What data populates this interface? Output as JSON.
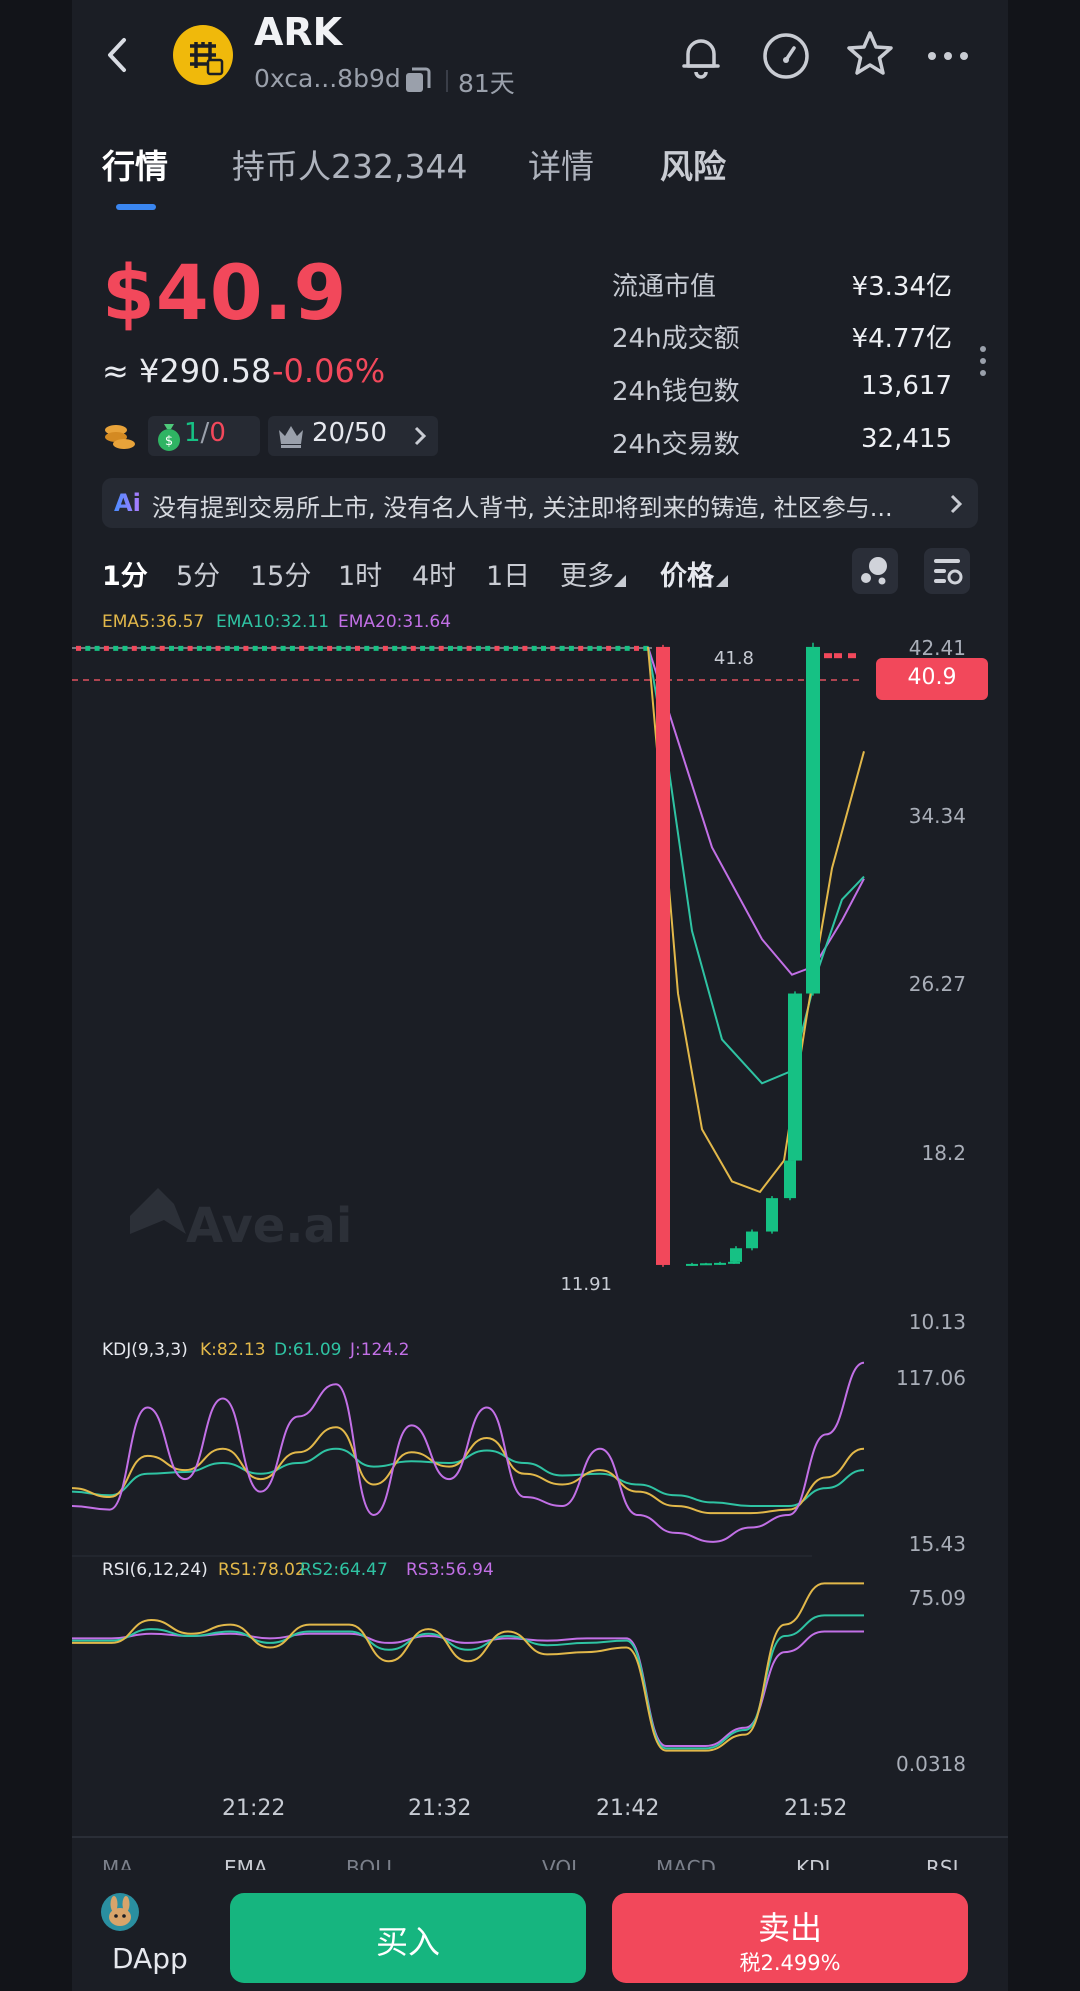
{
  "header": {
    "title": "ARK",
    "address": "0xca...8b9d",
    "age": "81天"
  },
  "tabs": [
    {
      "label": "行情",
      "active": true
    },
    {
      "label": "持币人232,344",
      "active": false
    },
    {
      "label": "详情",
      "active": false
    },
    {
      "label": "风险",
      "active": false
    }
  ],
  "price": {
    "usd": "$40.9",
    "cny": "≈ ¥290.58",
    "change": "-0.06%"
  },
  "chips": {
    "buy_sell_buy": "1",
    "buy_sell_sep": "/",
    "buy_sell_sell": "0",
    "top_holders": "20/50"
  },
  "stats": [
    {
      "label": "流通市值",
      "value": "¥3.34亿"
    },
    {
      "label": "24h成交额",
      "value": "¥4.77亿"
    },
    {
      "label": "24h钱包数",
      "value": "13,617"
    },
    {
      "label": "24h交易数",
      "value": "32,415"
    }
  ],
  "ai_summary": "没有提到交易所上市, 没有名人背书, 关注即将到来的铸造, 社区参与...",
  "timeframes": [
    {
      "label": "1分",
      "active": true
    },
    {
      "label": "5分",
      "active": false
    },
    {
      "label": "15分",
      "active": false
    },
    {
      "label": "1时",
      "active": false
    },
    {
      "label": "4时",
      "active": false
    },
    {
      "label": "1日",
      "active": false
    },
    {
      "label": "更多",
      "active": false
    },
    {
      "label": "价格",
      "active": false
    }
  ],
  "chart_data": {
    "type": "candlestick",
    "ema_legend": {
      "ema5": "EMA5:36.57",
      "ema10": "EMA10:32.11",
      "ema20": "EMA20:31.64"
    },
    "price_axis": [
      "42.41",
      "34.34",
      "26.27",
      "18.2",
      "10.13"
    ],
    "current_price_tag": "40.9",
    "high_label": "41.8",
    "low_label": "11.91",
    "time_labels": [
      "21:22",
      "21:32",
      "21:42",
      "21:52"
    ],
    "watermark": "Ave.ai",
    "price_range": [
      10.13,
      42.41
    ],
    "candles": [
      {
        "o": 41.6,
        "h": 41.7,
        "l": 11.91,
        "c": 12.0
      },
      {
        "o": 12.0,
        "h": 12.1,
        "l": 11.95,
        "c": 12.05
      },
      {
        "o": 12.05,
        "h": 12.1,
        "l": 12.0,
        "c": 12.08
      },
      {
        "o": 12.08,
        "h": 12.15,
        "l": 12.0,
        "c": 12.1
      },
      {
        "o": 12.1,
        "h": 12.2,
        "l": 12.05,
        "c": 12.15
      },
      {
        "o": 12.15,
        "h": 12.9,
        "l": 12.1,
        "c": 12.8
      },
      {
        "o": 12.8,
        "h": 13.7,
        "l": 12.7,
        "c": 13.6
      },
      {
        "o": 13.6,
        "h": 15.3,
        "l": 13.5,
        "c": 15.2
      },
      {
        "o": 15.2,
        "h": 17.1,
        "l": 15.1,
        "c": 17.0
      },
      {
        "o": 17.0,
        "h": 25.1,
        "l": 16.9,
        "c": 25.0
      },
      {
        "o": 25.0,
        "h": 41.8,
        "l": 24.9,
        "c": 41.6
      }
    ],
    "kdj": {
      "legend": {
        "name": "KDJ(9,3,3)",
        "k": "K:82.13",
        "d": "D:61.09",
        "j": "J:124.2"
      },
      "axis": [
        "117.06",
        "15.43"
      ],
      "range": [
        15.43,
        117.06
      ],
      "k": [
        50,
        45,
        68,
        60,
        72,
        55,
        70,
        84,
        52,
        70,
        62,
        78,
        58,
        52,
        60,
        48,
        40,
        36,
        36,
        38,
        56,
        72
      ],
      "d": [
        48,
        46,
        58,
        59,
        64,
        58,
        64,
        72,
        62,
        65,
        64,
        71,
        64,
        57,
        58,
        52,
        46,
        42,
        40,
        40,
        50,
        60
      ],
      "j": [
        40,
        38,
        95,
        55,
        100,
        48,
        90,
        108,
        35,
        85,
        55,
        95,
        45,
        40,
        72,
        35,
        25,
        20,
        28,
        35,
        80,
        120
      ]
    },
    "rsi": {
      "legend": {
        "name": "RSI(6,12,24)",
        "rs1": "RS1:78.02",
        "rs2": "RS2:64.47",
        "rs3": "RS3:56.94"
      },
      "axis": [
        "75.09",
        "0.0318"
      ],
      "range": [
        0.0318,
        75.09
      ],
      "rs1": [
        52,
        52,
        62,
        56,
        60,
        50,
        60,
        60,
        44,
        58,
        44,
        57,
        47,
        48,
        50,
        5,
        5,
        12,
        60,
        78,
        78
      ],
      "rs2": [
        53,
        53,
        58,
        55,
        57,
        52,
        57,
        57,
        49,
        56,
        49,
        55,
        51,
        52,
        53,
        6,
        6,
        14,
        55,
        64,
        64
      ],
      "rs3": [
        54,
        54,
        56,
        55,
        56,
        54,
        56,
        56,
        52,
        55,
        52,
        54,
        53,
        54,
        54,
        7,
        7,
        15,
        48,
        57,
        57
      ]
    }
  },
  "bottom_indicators": [
    "MA",
    "EMA",
    "BOLL",
    "VOL",
    "MACD",
    "KDJ",
    "RSI"
  ],
  "footer": {
    "dapp_label": "DApp",
    "buy_label": "买入",
    "sell_label": "卖出",
    "sell_tax": "税2.499%"
  },
  "colors": {
    "up": "#16c184",
    "down": "#f2485b",
    "ema5": "#e2b84a",
    "ema10": "#2fc3a3",
    "ema20": "#c270e6",
    "accent": "#3a86f0"
  }
}
